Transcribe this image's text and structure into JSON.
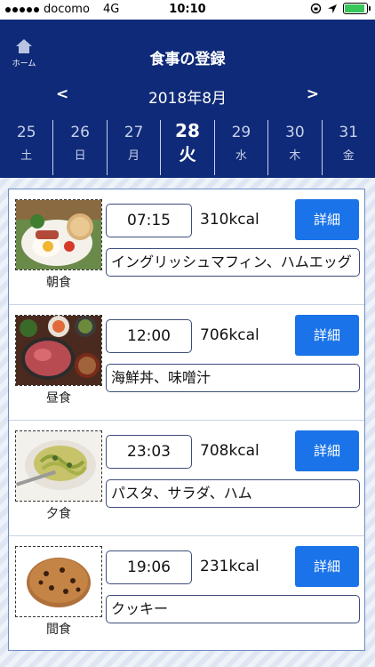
{
  "status_bar": {
    "carrier": "docomo",
    "network": "4G",
    "time": "10:10",
    "battery_level": 0.9
  },
  "header": {
    "home_label": "ホーム",
    "title": "食事の登録",
    "prev": "<",
    "next": ">",
    "month": "2018年8月"
  },
  "days": [
    {
      "num": "25",
      "weekday": "土"
    },
    {
      "num": "26",
      "weekday": "日"
    },
    {
      "num": "27",
      "weekday": "月"
    },
    {
      "num": "28",
      "weekday": "火"
    },
    {
      "num": "29",
      "weekday": "水"
    },
    {
      "num": "30",
      "weekday": "木"
    },
    {
      "num": "31",
      "weekday": "金"
    }
  ],
  "selected_day_index": 3,
  "meals": [
    {
      "type": "朝食",
      "time": "07:15",
      "kcal": "310kcal",
      "menu": "イングリッシュマフィン、ハムエッグ",
      "detail": "詳細"
    },
    {
      "type": "昼食",
      "time": "12:00",
      "kcal": "706kcal",
      "menu": "海鮮丼、味噌汁",
      "detail": "詳細"
    },
    {
      "type": "夕食",
      "time": "23:03",
      "kcal": "708kcal",
      "menu": "パスタ、サラダ、ハム",
      "detail": "詳細"
    },
    {
      "type": "間食",
      "time": "19:06",
      "kcal": "231kcal",
      "menu": "クッキー",
      "detail": "詳細"
    }
  ],
  "colors": {
    "header_bg": "#0f2a78",
    "detail_button": "#1a73e8",
    "battery": "#35c759"
  }
}
